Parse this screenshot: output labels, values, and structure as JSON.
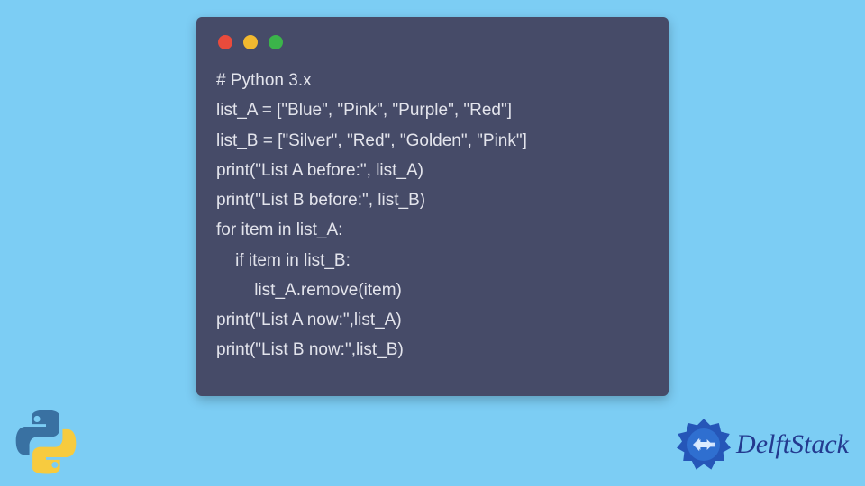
{
  "code": {
    "lines": [
      "# Python 3.x",
      "list_A = [\"Blue\", \"Pink\", \"Purple\", \"Red\"]",
      "list_B = [\"Silver\", \"Red\", \"Golden\", \"Pink\"]",
      "print(\"List A before:\", list_A)",
      "print(\"List B before:\", list_B)",
      "for item in list_A:",
      "    if item in list_B:",
      "        list_A.remove(item)",
      "print(\"List A now:\",list_A)",
      "print(\"List B now:\",list_B)"
    ]
  },
  "brand": {
    "name": "DelftStack"
  },
  "colors": {
    "bg": "#7ccdf4",
    "window": "#464b68",
    "code_text": "#e3e4ec",
    "brand_text": "#233a8f",
    "traffic_red": "#e94b3c",
    "traffic_yellow": "#f2b92f",
    "traffic_green": "#3bb44a"
  }
}
